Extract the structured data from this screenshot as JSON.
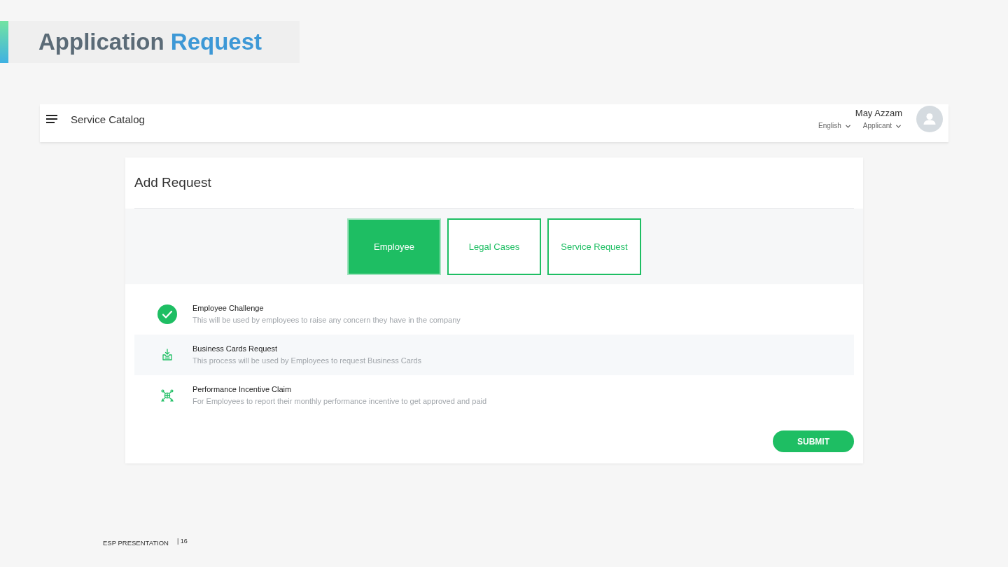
{
  "slide_title": {
    "text": "Application",
    "highlight": "Request"
  },
  "top_bar": {
    "title": "Service Catalog",
    "user_name": "May Azzam",
    "language": "English",
    "role": "Applicant"
  },
  "card": {
    "title": "Add Request",
    "tabs": [
      {
        "label": "Employee",
        "selected": true
      },
      {
        "label": "Legal Cases",
        "selected": false
      },
      {
        "label": "Service Request",
        "selected": false
      }
    ],
    "services": [
      {
        "name": "Employee Challenge",
        "description": "This will be used by employees to raise any concern they have in the company",
        "selected": true
      },
      {
        "name": "Business Cards Request",
        "description": "This process will be used by Employees to request Business Cards",
        "selected": false
      },
      {
        "name": "Performance Incentive Claim",
        "description": "For Employees to report their monthly performance incentive to get approved and paid",
        "selected": false
      }
    ],
    "submit_button": "SUBMIT"
  },
  "footer": {
    "label": "ESP PRESENTATION",
    "page": "| 16"
  }
}
